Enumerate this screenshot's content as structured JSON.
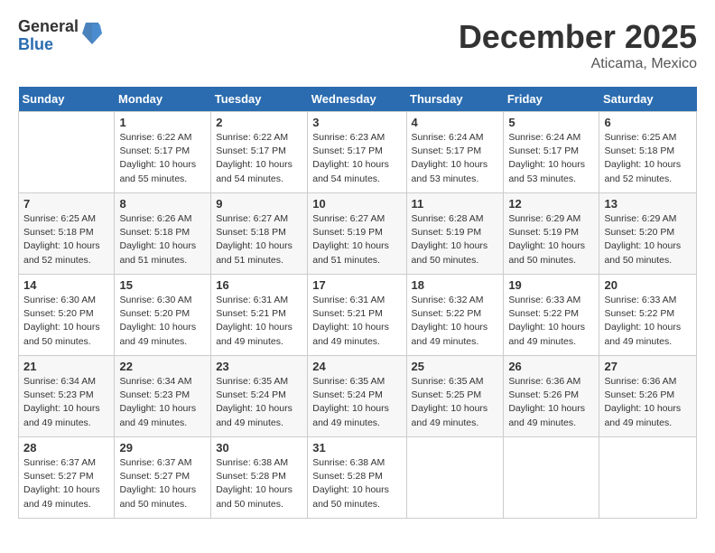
{
  "header": {
    "logo": {
      "general": "General",
      "blue": "Blue"
    },
    "title": "December 2025",
    "subtitle": "Aticama, Mexico"
  },
  "days_of_week": [
    "Sunday",
    "Monday",
    "Tuesday",
    "Wednesday",
    "Thursday",
    "Friday",
    "Saturday"
  ],
  "weeks": [
    [
      {
        "day": "",
        "sunrise": "",
        "sunset": "",
        "daylight": ""
      },
      {
        "day": "1",
        "sunrise": "Sunrise: 6:22 AM",
        "sunset": "Sunset: 5:17 PM",
        "daylight": "Daylight: 10 hours and 55 minutes."
      },
      {
        "day": "2",
        "sunrise": "Sunrise: 6:22 AM",
        "sunset": "Sunset: 5:17 PM",
        "daylight": "Daylight: 10 hours and 54 minutes."
      },
      {
        "day": "3",
        "sunrise": "Sunrise: 6:23 AM",
        "sunset": "Sunset: 5:17 PM",
        "daylight": "Daylight: 10 hours and 54 minutes."
      },
      {
        "day": "4",
        "sunrise": "Sunrise: 6:24 AM",
        "sunset": "Sunset: 5:17 PM",
        "daylight": "Daylight: 10 hours and 53 minutes."
      },
      {
        "day": "5",
        "sunrise": "Sunrise: 6:24 AM",
        "sunset": "Sunset: 5:17 PM",
        "daylight": "Daylight: 10 hours and 53 minutes."
      },
      {
        "day": "6",
        "sunrise": "Sunrise: 6:25 AM",
        "sunset": "Sunset: 5:18 PM",
        "daylight": "Daylight: 10 hours and 52 minutes."
      }
    ],
    [
      {
        "day": "7",
        "sunrise": "Sunrise: 6:25 AM",
        "sunset": "Sunset: 5:18 PM",
        "daylight": "Daylight: 10 hours and 52 minutes."
      },
      {
        "day": "8",
        "sunrise": "Sunrise: 6:26 AM",
        "sunset": "Sunset: 5:18 PM",
        "daylight": "Daylight: 10 hours and 51 minutes."
      },
      {
        "day": "9",
        "sunrise": "Sunrise: 6:27 AM",
        "sunset": "Sunset: 5:18 PM",
        "daylight": "Daylight: 10 hours and 51 minutes."
      },
      {
        "day": "10",
        "sunrise": "Sunrise: 6:27 AM",
        "sunset": "Sunset: 5:19 PM",
        "daylight": "Daylight: 10 hours and 51 minutes."
      },
      {
        "day": "11",
        "sunrise": "Sunrise: 6:28 AM",
        "sunset": "Sunset: 5:19 PM",
        "daylight": "Daylight: 10 hours and 50 minutes."
      },
      {
        "day": "12",
        "sunrise": "Sunrise: 6:29 AM",
        "sunset": "Sunset: 5:19 PM",
        "daylight": "Daylight: 10 hours and 50 minutes."
      },
      {
        "day": "13",
        "sunrise": "Sunrise: 6:29 AM",
        "sunset": "Sunset: 5:20 PM",
        "daylight": "Daylight: 10 hours and 50 minutes."
      }
    ],
    [
      {
        "day": "14",
        "sunrise": "Sunrise: 6:30 AM",
        "sunset": "Sunset: 5:20 PM",
        "daylight": "Daylight: 10 hours and 50 minutes."
      },
      {
        "day": "15",
        "sunrise": "Sunrise: 6:30 AM",
        "sunset": "Sunset: 5:20 PM",
        "daylight": "Daylight: 10 hours and 49 minutes."
      },
      {
        "day": "16",
        "sunrise": "Sunrise: 6:31 AM",
        "sunset": "Sunset: 5:21 PM",
        "daylight": "Daylight: 10 hours and 49 minutes."
      },
      {
        "day": "17",
        "sunrise": "Sunrise: 6:31 AM",
        "sunset": "Sunset: 5:21 PM",
        "daylight": "Daylight: 10 hours and 49 minutes."
      },
      {
        "day": "18",
        "sunrise": "Sunrise: 6:32 AM",
        "sunset": "Sunset: 5:22 PM",
        "daylight": "Daylight: 10 hours and 49 minutes."
      },
      {
        "day": "19",
        "sunrise": "Sunrise: 6:33 AM",
        "sunset": "Sunset: 5:22 PM",
        "daylight": "Daylight: 10 hours and 49 minutes."
      },
      {
        "day": "20",
        "sunrise": "Sunrise: 6:33 AM",
        "sunset": "Sunset: 5:22 PM",
        "daylight": "Daylight: 10 hours and 49 minutes."
      }
    ],
    [
      {
        "day": "21",
        "sunrise": "Sunrise: 6:34 AM",
        "sunset": "Sunset: 5:23 PM",
        "daylight": "Daylight: 10 hours and 49 minutes."
      },
      {
        "day": "22",
        "sunrise": "Sunrise: 6:34 AM",
        "sunset": "Sunset: 5:23 PM",
        "daylight": "Daylight: 10 hours and 49 minutes."
      },
      {
        "day": "23",
        "sunrise": "Sunrise: 6:35 AM",
        "sunset": "Sunset: 5:24 PM",
        "daylight": "Daylight: 10 hours and 49 minutes."
      },
      {
        "day": "24",
        "sunrise": "Sunrise: 6:35 AM",
        "sunset": "Sunset: 5:24 PM",
        "daylight": "Daylight: 10 hours and 49 minutes."
      },
      {
        "day": "25",
        "sunrise": "Sunrise: 6:35 AM",
        "sunset": "Sunset: 5:25 PM",
        "daylight": "Daylight: 10 hours and 49 minutes."
      },
      {
        "day": "26",
        "sunrise": "Sunrise: 6:36 AM",
        "sunset": "Sunset: 5:26 PM",
        "daylight": "Daylight: 10 hours and 49 minutes."
      },
      {
        "day": "27",
        "sunrise": "Sunrise: 6:36 AM",
        "sunset": "Sunset: 5:26 PM",
        "daylight": "Daylight: 10 hours and 49 minutes."
      }
    ],
    [
      {
        "day": "28",
        "sunrise": "Sunrise: 6:37 AM",
        "sunset": "Sunset: 5:27 PM",
        "daylight": "Daylight: 10 hours and 49 minutes."
      },
      {
        "day": "29",
        "sunrise": "Sunrise: 6:37 AM",
        "sunset": "Sunset: 5:27 PM",
        "daylight": "Daylight: 10 hours and 50 minutes."
      },
      {
        "day": "30",
        "sunrise": "Sunrise: 6:38 AM",
        "sunset": "Sunset: 5:28 PM",
        "daylight": "Daylight: 10 hours and 50 minutes."
      },
      {
        "day": "31",
        "sunrise": "Sunrise: 6:38 AM",
        "sunset": "Sunset: 5:28 PM",
        "daylight": "Daylight: 10 hours and 50 minutes."
      },
      {
        "day": "",
        "sunrise": "",
        "sunset": "",
        "daylight": ""
      },
      {
        "day": "",
        "sunrise": "",
        "sunset": "",
        "daylight": ""
      },
      {
        "day": "",
        "sunrise": "",
        "sunset": "",
        "daylight": ""
      }
    ]
  ]
}
